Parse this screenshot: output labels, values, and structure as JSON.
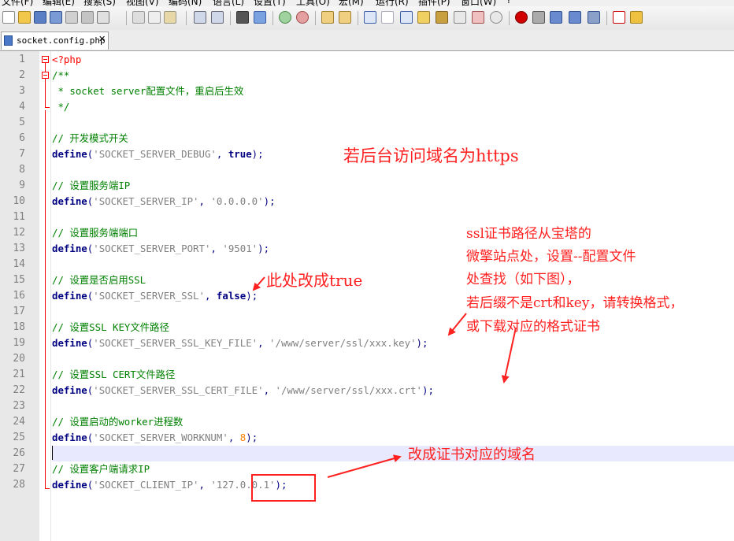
{
  "menu": [
    "文件(F)",
    "编辑(E)",
    "搜索(S)",
    "视图(V)",
    "编码(N)",
    "语言(L)",
    "设置(T)",
    "工具(O)",
    "宏(M)",
    "运行(R)",
    "插件(P)",
    "窗口(W)",
    "?"
  ],
  "tab": {
    "filename": "socket.config.php",
    "close": "✕"
  },
  "lines": [
    {
      "n": "1",
      "t": "<?php"
    },
    {
      "n": "2",
      "t": "/**"
    },
    {
      "n": "3",
      "t": " * socket server配置文件，重启后生效"
    },
    {
      "n": "4",
      "t": " */"
    },
    {
      "n": "5",
      "t": ""
    },
    {
      "n": "6",
      "t": "// 开发模式开关"
    },
    {
      "n": "7",
      "t": "define('SOCKET_SERVER_DEBUG', true);"
    },
    {
      "n": "8",
      "t": ""
    },
    {
      "n": "9",
      "t": "// 设置服务端IP"
    },
    {
      "n": "10",
      "t": "define('SOCKET_SERVER_IP', '0.0.0.0');"
    },
    {
      "n": "11",
      "t": ""
    },
    {
      "n": "12",
      "t": "// 设置服务端端口"
    },
    {
      "n": "13",
      "t": "define('SOCKET_SERVER_PORT', '9501');"
    },
    {
      "n": "14",
      "t": ""
    },
    {
      "n": "15",
      "t": "// 设置是否启用SSL"
    },
    {
      "n": "16",
      "t": "define('SOCKET_SERVER_SSL', false);"
    },
    {
      "n": "17",
      "t": ""
    },
    {
      "n": "18",
      "t": "// 设置SSL KEY文件路径"
    },
    {
      "n": "19",
      "t": "define('SOCKET_SERVER_SSL_KEY_FILE', '/www/server/ssl/xxx.key');"
    },
    {
      "n": "20",
      "t": ""
    },
    {
      "n": "21",
      "t": "// 设置SSL CERT文件路径"
    },
    {
      "n": "22",
      "t": "define('SOCKET_SERVER_SSL_CERT_FILE', '/www/server/ssl/xxx.crt');"
    },
    {
      "n": "23",
      "t": ""
    },
    {
      "n": "24",
      "t": "// 设置启动的worker进程数"
    },
    {
      "n": "25",
      "t": "define('SOCKET_SERVER_WORKNUM', 8);"
    },
    {
      "n": "26",
      "t": ""
    },
    {
      "n": "27",
      "t": "// 设置客户端请求IP"
    },
    {
      "n": "28",
      "t": "define('SOCKET_CLIENT_IP', '127.0.0.1');"
    }
  ],
  "annotations": {
    "https": "若后台访问域名为https",
    "ssl_true": "此处改成true",
    "ssl_1": "ssl证书路径从宝塔的",
    "ssl_2": "微擎站点处，设置--配置文件",
    "ssl_3": "处查找（如下图），",
    "ssl_4": "若后缀不是crt和key，请转换格式，",
    "ssl_5": "或下载对应的格式证书",
    "domain": "改成证书对应的域名"
  },
  "colors": {
    "annotation": "#ff2020",
    "keyword": "#000080",
    "string": "#808080",
    "comment": "#008000",
    "number": "#ff8000",
    "php_tag": "#ff0000"
  }
}
